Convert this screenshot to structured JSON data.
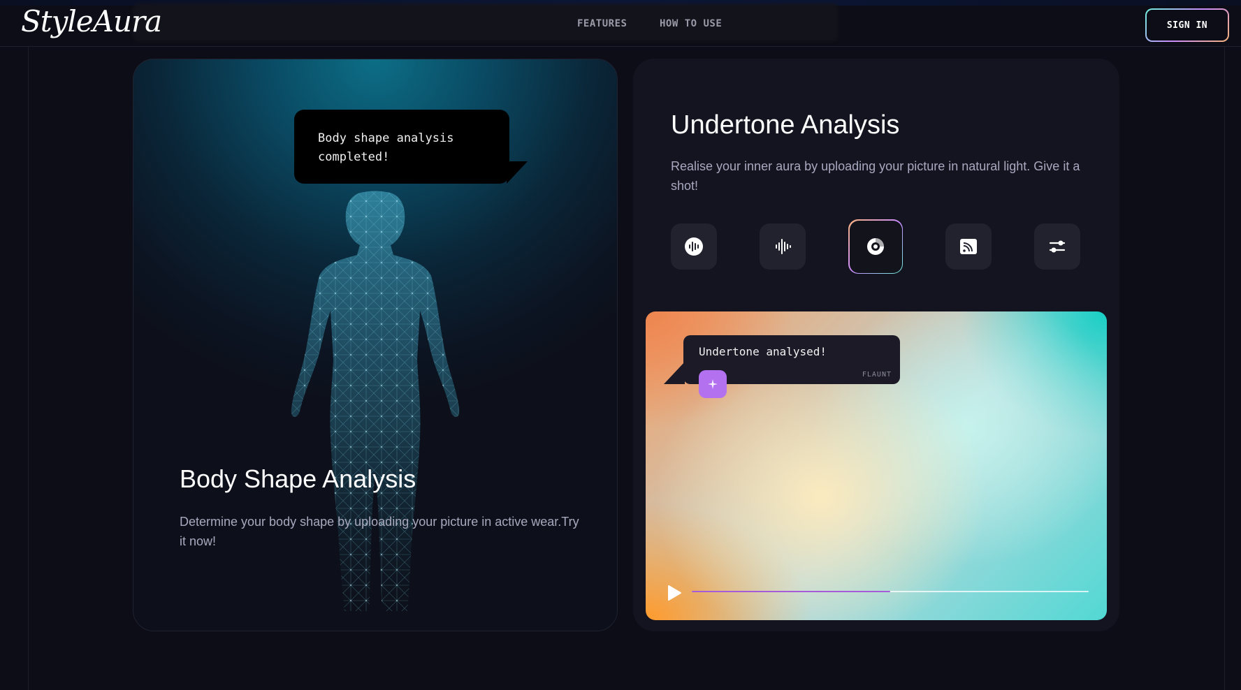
{
  "nav": {
    "logo": "StyleAura",
    "links": [
      "FEATURES",
      "HOW TO USE"
    ],
    "signin_label": "SIGN IN"
  },
  "body_shape": {
    "bubble": [
      "Body shape analysis",
      "completed!"
    ],
    "title": "Body Shape Analysis",
    "description": "Determine your body shape by uploading your picture in active wear.Try it now!"
  },
  "undertone": {
    "title": "Undertone Analysis",
    "description": "Realise your inner aura by uploading your picture in natural light. Give it a shot!",
    "icons": [
      "audio-wave-circle-icon",
      "audio-bars-icon",
      "vinyl-disc-icon",
      "cast-icon",
      "sliders-icon"
    ],
    "active_icon_index": 2,
    "media": {
      "bubble_text": "Undertone analysed!",
      "bubble_brand": "FLAUNT",
      "progress": 0.5
    }
  },
  "colors": {
    "background": "#0d0d17",
    "card_right": "#141420",
    "accent_purple": "#b371f0"
  }
}
